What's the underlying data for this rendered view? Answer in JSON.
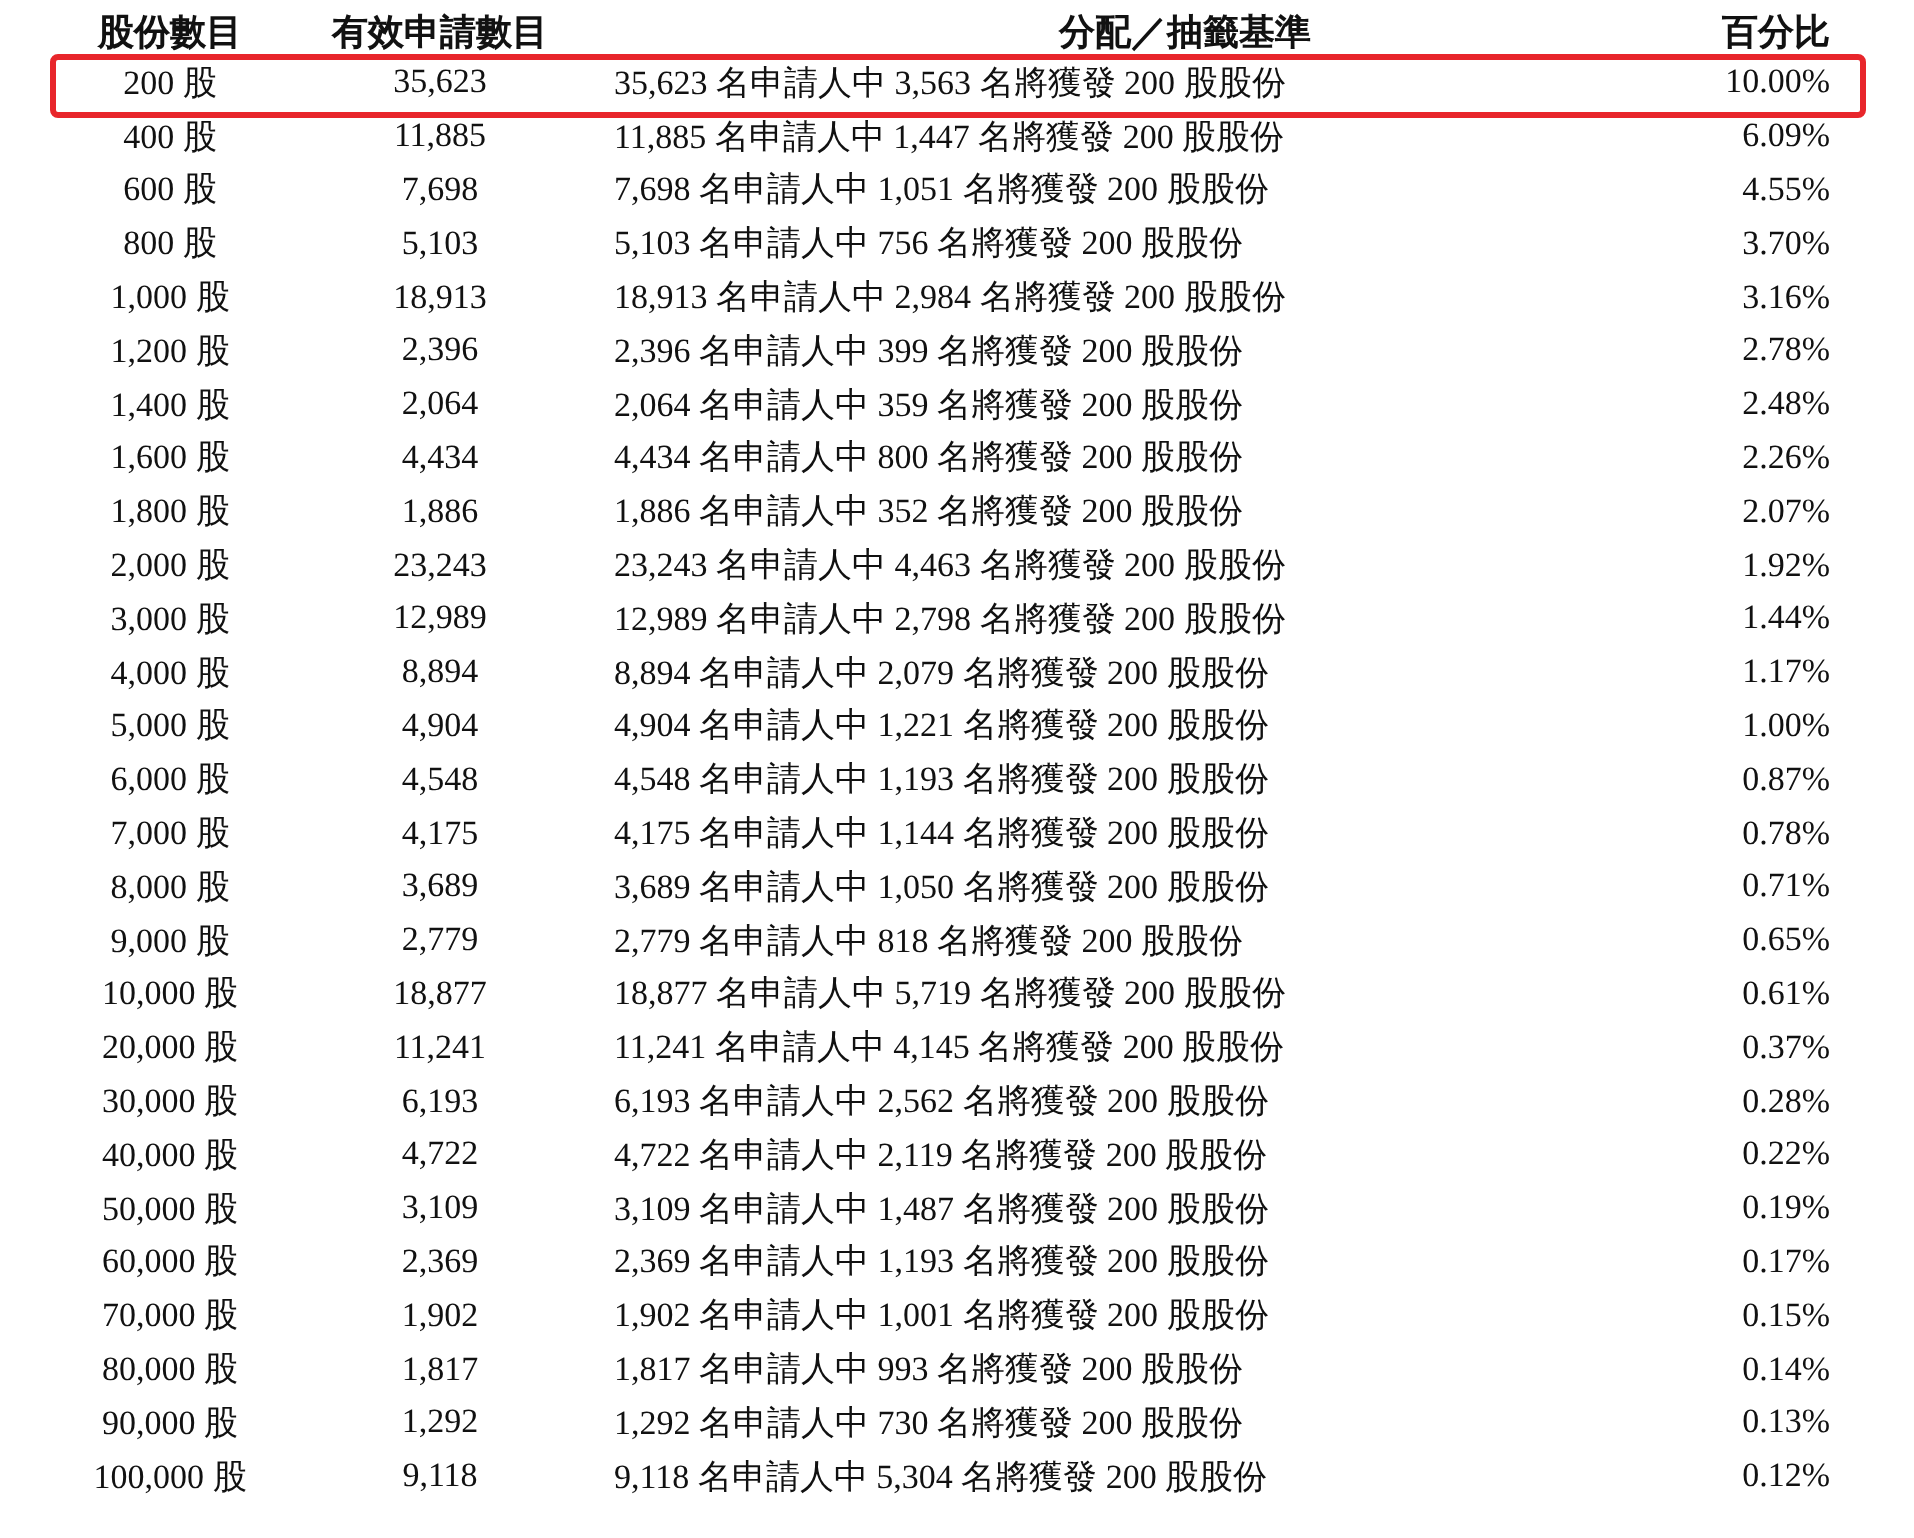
{
  "table": {
    "columns": [
      "股份數目",
      "有效申請數目",
      "分配／抽籤基準",
      "百分比"
    ],
    "rows": [
      {
        "shares": "200 股",
        "applications": "35,623",
        "basis": "35,623 名申請人中 3,563 名將獲發 200 股股份",
        "percent": "10.00%",
        "highlighted": true
      },
      {
        "shares": "400 股",
        "applications": "11,885",
        "basis": "11,885 名申請人中 1,447 名將獲發 200 股股份",
        "percent": "6.09%",
        "highlighted": false
      },
      {
        "shares": "600 股",
        "applications": "7,698",
        "basis": "7,698 名申請人中 1,051 名將獲發 200 股股份",
        "percent": "4.55%",
        "highlighted": false
      },
      {
        "shares": "800 股",
        "applications": "5,103",
        "basis": "5,103 名申請人中 756 名將獲發 200 股股份",
        "percent": "3.70%",
        "highlighted": false
      },
      {
        "shares": "1,000 股",
        "applications": "18,913",
        "basis": "18,913 名申請人中 2,984 名將獲發 200 股股份",
        "percent": "3.16%",
        "highlighted": false
      },
      {
        "shares": "1,200 股",
        "applications": "2,396",
        "basis": "2,396 名申請人中 399 名將獲發 200 股股份",
        "percent": "2.78%",
        "highlighted": false
      },
      {
        "shares": "1,400 股",
        "applications": "2,064",
        "basis": "2,064 名申請人中 359 名將獲發 200 股股份",
        "percent": "2.48%",
        "highlighted": false
      },
      {
        "shares": "1,600 股",
        "applications": "4,434",
        "basis": "4,434 名申請人中 800 名將獲發 200 股股份",
        "percent": "2.26%",
        "highlighted": false
      },
      {
        "shares": "1,800 股",
        "applications": "1,886",
        "basis": "1,886 名申請人中 352 名將獲發 200 股股份",
        "percent": "2.07%",
        "highlighted": false
      },
      {
        "shares": "2,000 股",
        "applications": "23,243",
        "basis": "23,243 名申請人中 4,463 名將獲發 200 股股份",
        "percent": "1.92%",
        "highlighted": false
      },
      {
        "shares": "3,000 股",
        "applications": "12,989",
        "basis": "12,989 名申請人中 2,798 名將獲發 200 股股份",
        "percent": "1.44%",
        "highlighted": false
      },
      {
        "shares": "4,000 股",
        "applications": "8,894",
        "basis": "8,894 名申請人中 2,079 名將獲發 200 股股份",
        "percent": "1.17%",
        "highlighted": false
      },
      {
        "shares": "5,000 股",
        "applications": "4,904",
        "basis": "4,904 名申請人中 1,221 名將獲發 200 股股份",
        "percent": "1.00%",
        "highlighted": false
      },
      {
        "shares": "6,000 股",
        "applications": "4,548",
        "basis": "4,548 名申請人中 1,193 名將獲發 200 股股份",
        "percent": "0.87%",
        "highlighted": false
      },
      {
        "shares": "7,000 股",
        "applications": "4,175",
        "basis": "4,175 名申請人中 1,144 名將獲發 200 股股份",
        "percent": "0.78%",
        "highlighted": false
      },
      {
        "shares": "8,000 股",
        "applications": "3,689",
        "basis": "3,689 名申請人中 1,050 名將獲發 200 股股份",
        "percent": "0.71%",
        "highlighted": false
      },
      {
        "shares": "9,000 股",
        "applications": "2,779",
        "basis": "2,779 名申請人中 818 名將獲發 200 股股份",
        "percent": "0.65%",
        "highlighted": false
      },
      {
        "shares": "10,000 股",
        "applications": "18,877",
        "basis": "18,877 名申請人中 5,719 名將獲發 200 股股份",
        "percent": "0.61%",
        "highlighted": false
      },
      {
        "shares": "20,000 股",
        "applications": "11,241",
        "basis": "11,241 名申請人中 4,145 名將獲發 200 股股份",
        "percent": "0.37%",
        "highlighted": false
      },
      {
        "shares": "30,000 股",
        "applications": "6,193",
        "basis": "6,193 名申請人中 2,562 名將獲發 200 股股份",
        "percent": "0.28%",
        "highlighted": false
      },
      {
        "shares": "40,000 股",
        "applications": "4,722",
        "basis": "4,722 名申請人中 2,119 名將獲發 200 股股份",
        "percent": "0.22%",
        "highlighted": false
      },
      {
        "shares": "50,000 股",
        "applications": "3,109",
        "basis": "3,109 名申請人中 1,487 名將獲發 200 股股份",
        "percent": "0.19%",
        "highlighted": false
      },
      {
        "shares": "60,000 股",
        "applications": "2,369",
        "basis": "2,369 名申請人中 1,193 名將獲發 200 股股份",
        "percent": "0.17%",
        "highlighted": false
      },
      {
        "shares": "70,000 股",
        "applications": "1,902",
        "basis": "1,902 名申請人中 1,001 名將獲發 200 股股份",
        "percent": "0.15%",
        "highlighted": false
      },
      {
        "shares": "80,000 股",
        "applications": "1,817",
        "basis": "1,817 名申請人中 993 名將獲發 200 股股份",
        "percent": "0.14%",
        "highlighted": false
      },
      {
        "shares": "90,000 股",
        "applications": "1,292",
        "basis": "1,292 名申請人中 730 名將獲發 200 股股份",
        "percent": "0.13%",
        "highlighted": false
      },
      {
        "shares": "100,000 股",
        "applications": "9,118",
        "basis": "9,118 名申請人中 5,304 名將獲發 200 股股份",
        "percent": "0.12%",
        "highlighted": false
      }
    ]
  }
}
